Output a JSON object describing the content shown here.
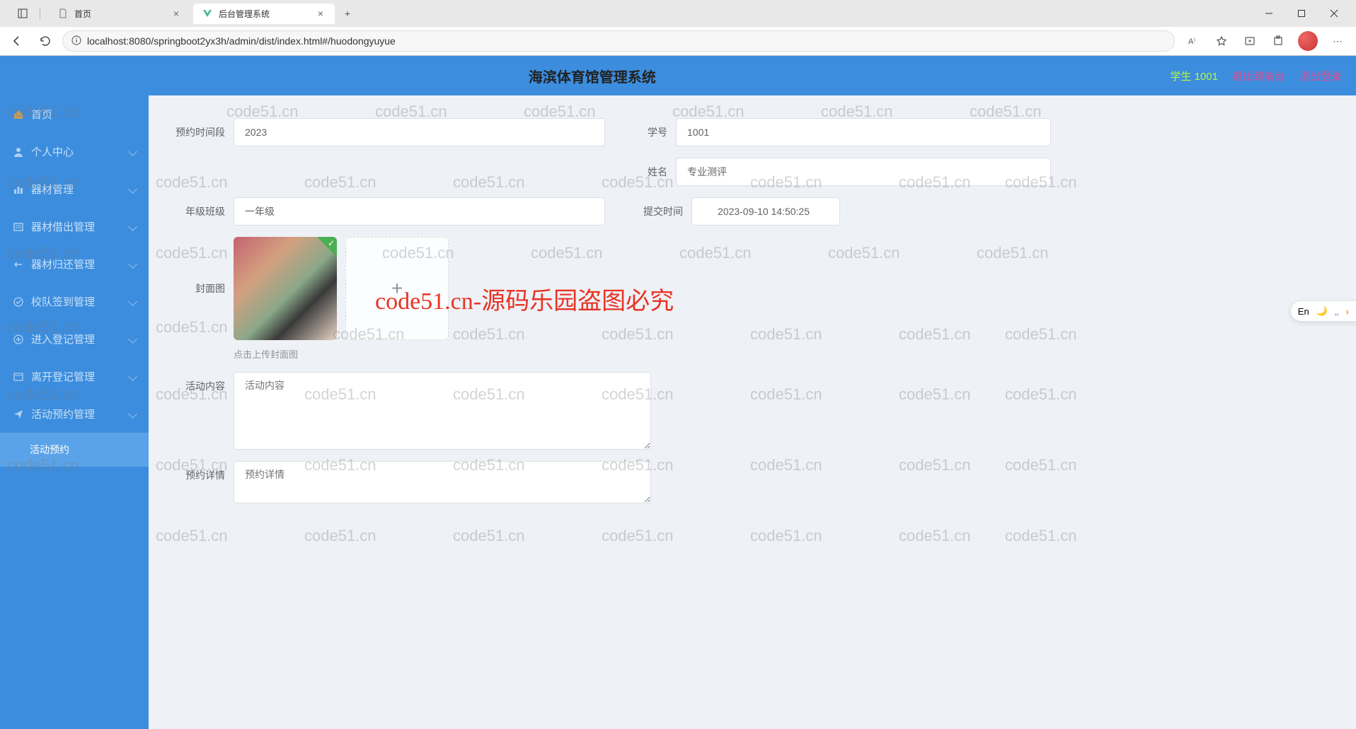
{
  "browser": {
    "tabs": [
      {
        "title": "首页",
        "icon": "page"
      },
      {
        "title": "后台管理系统",
        "icon": "vue",
        "active": true
      }
    ],
    "url": "localhost:8080/springboot2yx3h/admin/dist/index.html#/huodongyuyue"
  },
  "header": {
    "title": "海滨体育馆管理系统",
    "user_role": "学生",
    "user_id": "1001",
    "logout_front": "退出到前台",
    "logout": "退出登录"
  },
  "sidebar": {
    "items": [
      {
        "label": "首页",
        "icon": "home"
      },
      {
        "label": "个人中心",
        "icon": "user",
        "children": true
      },
      {
        "label": "器材管理",
        "icon": "chart",
        "children": true
      },
      {
        "label": "器材借出管理",
        "icon": "list",
        "children": true
      },
      {
        "label": "器材归还管理",
        "icon": "return",
        "children": true
      },
      {
        "label": "校队签到管理",
        "icon": "check",
        "children": true
      },
      {
        "label": "进入登记管理",
        "icon": "enter",
        "children": true
      },
      {
        "label": "离开登记管理",
        "icon": "leave",
        "children": true
      },
      {
        "label": "活动预约管理",
        "icon": "send",
        "children": true,
        "expanded": true
      }
    ],
    "active_sub": "活动预约"
  },
  "form": {
    "labels": {
      "time_slot": "预约时间段",
      "student_id": "学号",
      "name": "姓名",
      "grade": "年级班级",
      "submit_time": "提交时间",
      "cover": "封面图",
      "content": "活动内容",
      "detail": "预约详情"
    },
    "values": {
      "time_slot": "2023",
      "student_id": "1001",
      "name": "专业测评",
      "grade": "一年级",
      "submit_time": "2023-09-10 14:50:25"
    },
    "upload_hint": "点击上传封面图",
    "placeholders": {
      "content": "活动内容",
      "detail": "预约详情"
    }
  },
  "watermark": "code51.cn",
  "watermark_center": "code51.cn-源码乐园盗图必究",
  "float_widget": {
    "lang": "En"
  }
}
